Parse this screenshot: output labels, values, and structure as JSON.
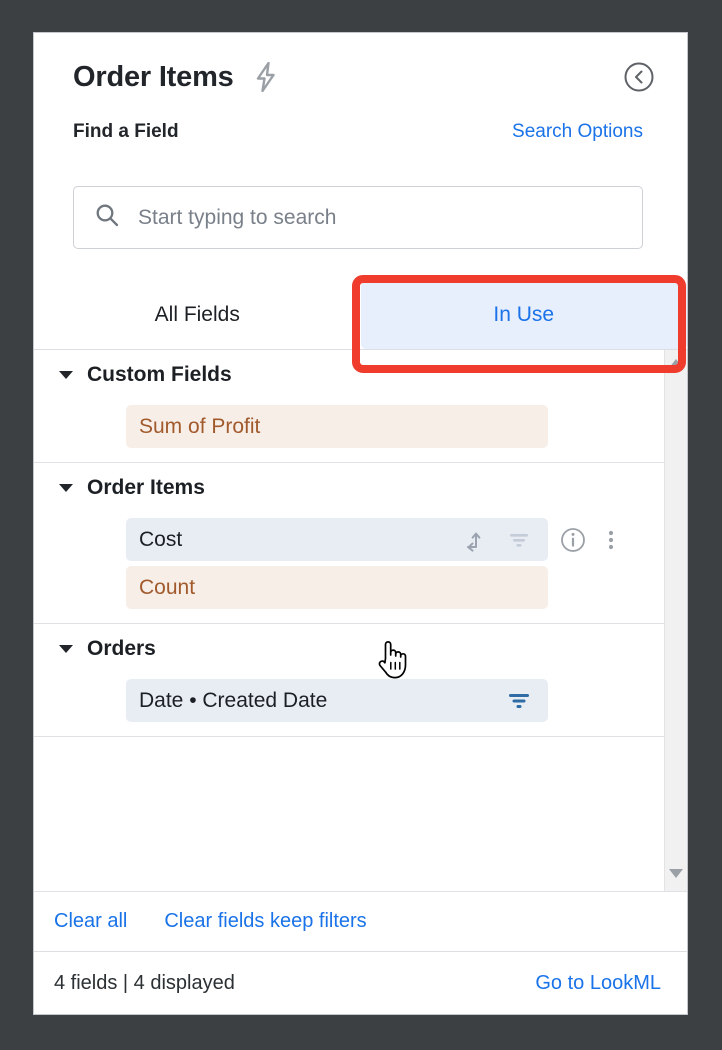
{
  "window": {
    "backdrop_color": "#3c4043",
    "panel_background": "#ffffff"
  },
  "header": {
    "title": "Order Items",
    "bolt_icon": "lightning-bolt-icon",
    "back_icon": "back-chevron-circle-icon"
  },
  "search": {
    "label": "Find a Field",
    "options_link": "Search Options",
    "placeholder": "Start typing to search",
    "value": "",
    "icon": "search-icon"
  },
  "tabs": [
    {
      "label": "All Fields",
      "active": false
    },
    {
      "label": "In Use",
      "active": true
    }
  ],
  "annotation": {
    "target": "In Use",
    "color": "#ef3c2d"
  },
  "groups": [
    {
      "name": "Custom Fields",
      "expanded": true,
      "fields": [
        {
          "label": "Sum of Profit",
          "kind": "measure",
          "icons": []
        }
      ]
    },
    {
      "name": "Order Items",
      "expanded": true,
      "fields": [
        {
          "label": "Cost",
          "kind": "dimension",
          "hovered": true,
          "icons": [
            "pivot-icon",
            "filter-icon",
            "info-icon",
            "more-options-icon"
          ]
        },
        {
          "label": "Count",
          "kind": "measure",
          "icons": []
        }
      ]
    },
    {
      "name": "Orders",
      "expanded": true,
      "fields": [
        {
          "label": "Date • Created Date",
          "kind": "dimension",
          "icons": [
            "filter-active-icon"
          ]
        }
      ]
    }
  ],
  "footer": {
    "clear_all": "Clear all",
    "clear_fields_keep_filters": "Clear fields keep filters",
    "status": "4 fields | 4 displayed",
    "lookml_link": "Go to LookML"
  },
  "colors": {
    "link_blue": "#1a73e8",
    "measure_bg": "#f8eee8",
    "measure_text": "#a05a2c",
    "dimension_bg": "#e8edf4",
    "active_tab_bg": "#e8effc",
    "filter_active": "#2f6ba5",
    "annotation_red": "#ef3c2d"
  },
  "scrollbar": {
    "up_arrow": "scroll-up-arrow-icon",
    "down_arrow": "scroll-down-arrow-icon"
  },
  "cursor": {
    "type": "pointing-hand-cursor"
  }
}
